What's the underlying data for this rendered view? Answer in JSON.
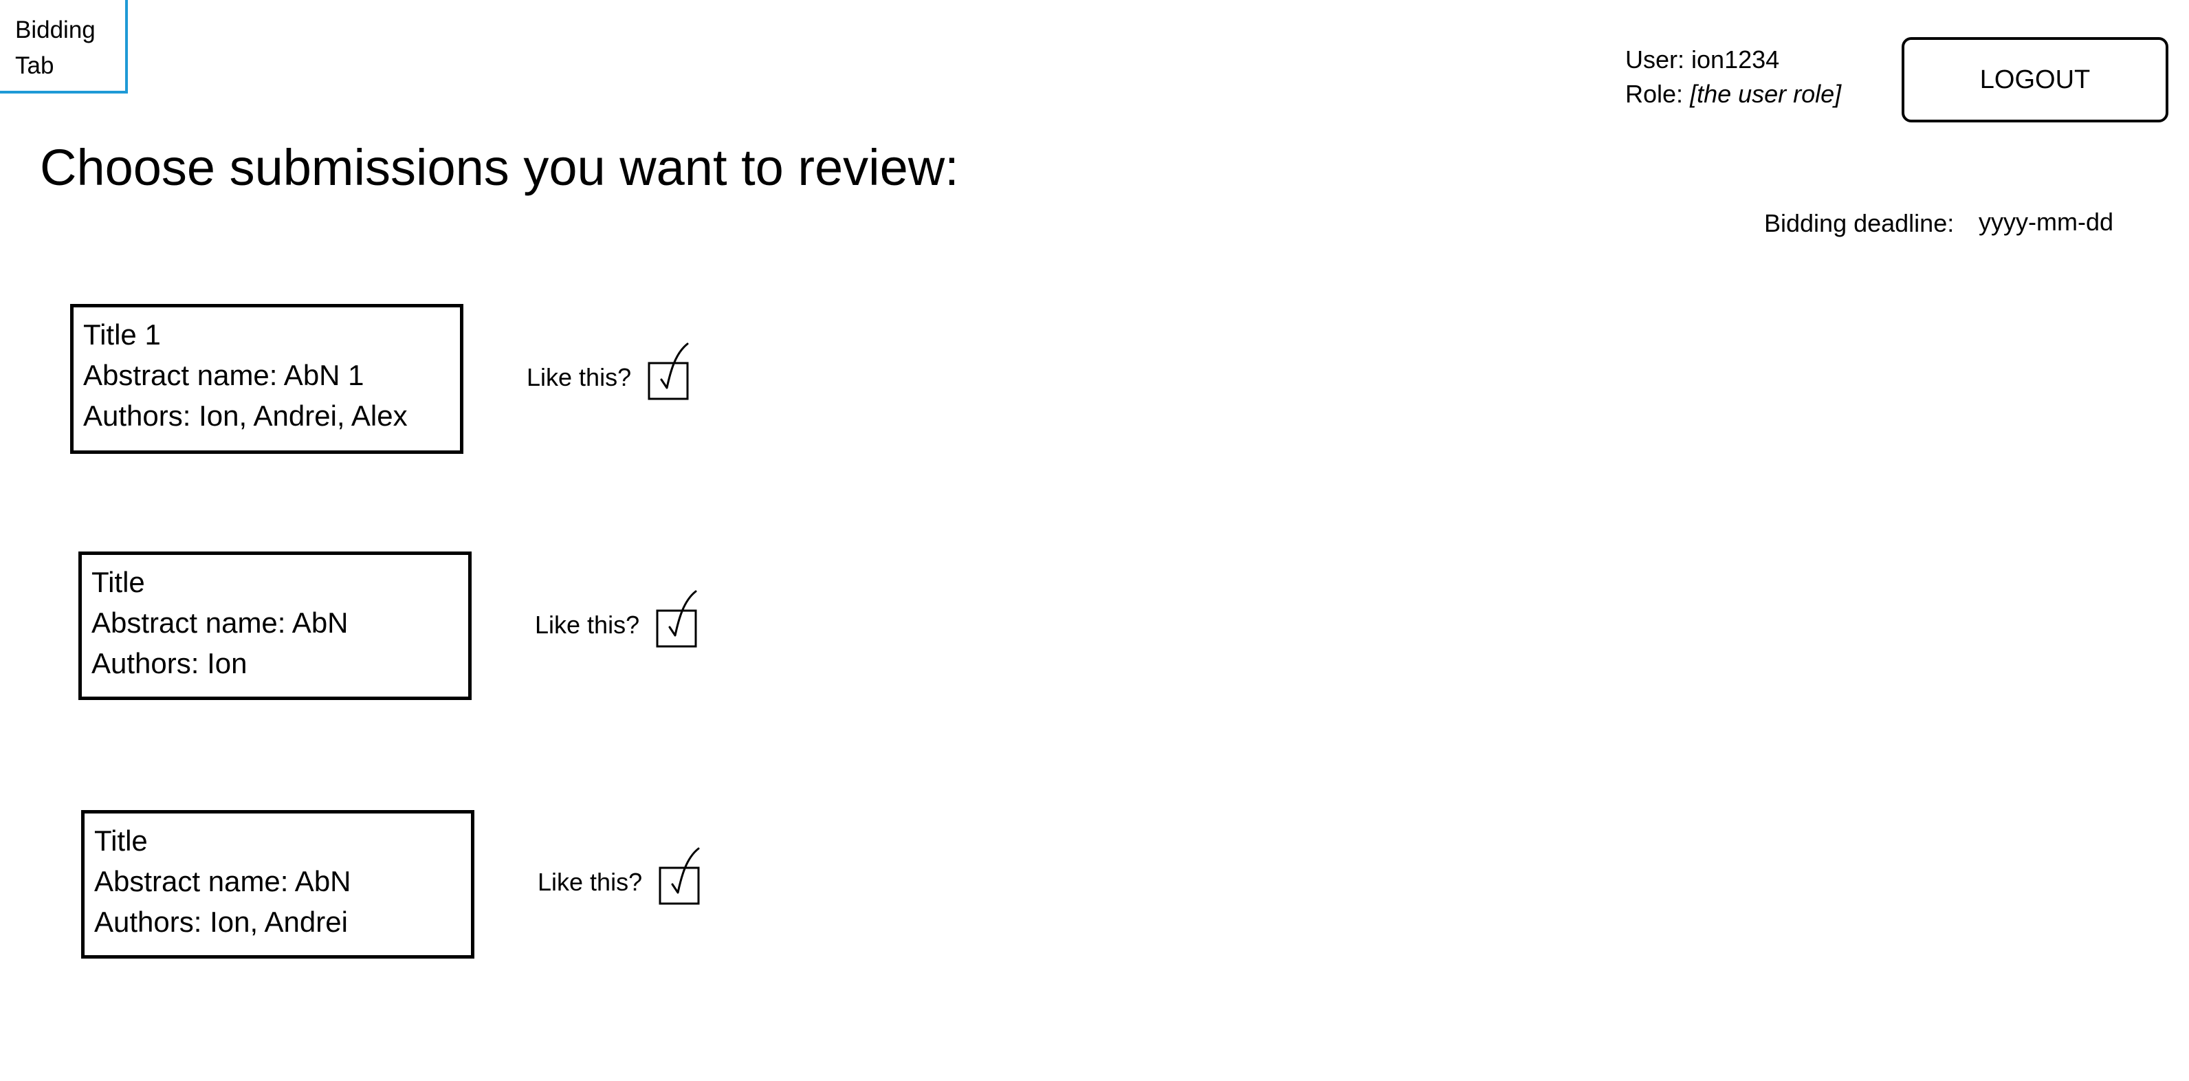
{
  "tab": {
    "label": "Bidding Tab"
  },
  "header": {
    "user_label": "User:",
    "user_value": "ion1234",
    "role_label": "Role:",
    "role_value": "[the user role]",
    "logout_label": "LOGOUT"
  },
  "main": {
    "title": "Choose submissions you want to review:",
    "deadline_label": "Bidding deadline:",
    "deadline_value": "yyyy-mm-dd"
  },
  "submissions": [
    {
      "title": "Title 1",
      "abstract": "Abstract name: AbN 1",
      "authors": "Authors: Ion, Andrei, Alex",
      "like_label": "Like this?",
      "liked": true
    },
    {
      "title": "Title",
      "abstract": "Abstract name: AbN",
      "authors": "Authors: Ion",
      "like_label": "Like this?",
      "liked": true
    },
    {
      "title": "Title",
      "abstract": "Abstract name: AbN",
      "authors": "Authors: Ion, Andrei",
      "like_label": "Like this?",
      "liked": true
    }
  ]
}
